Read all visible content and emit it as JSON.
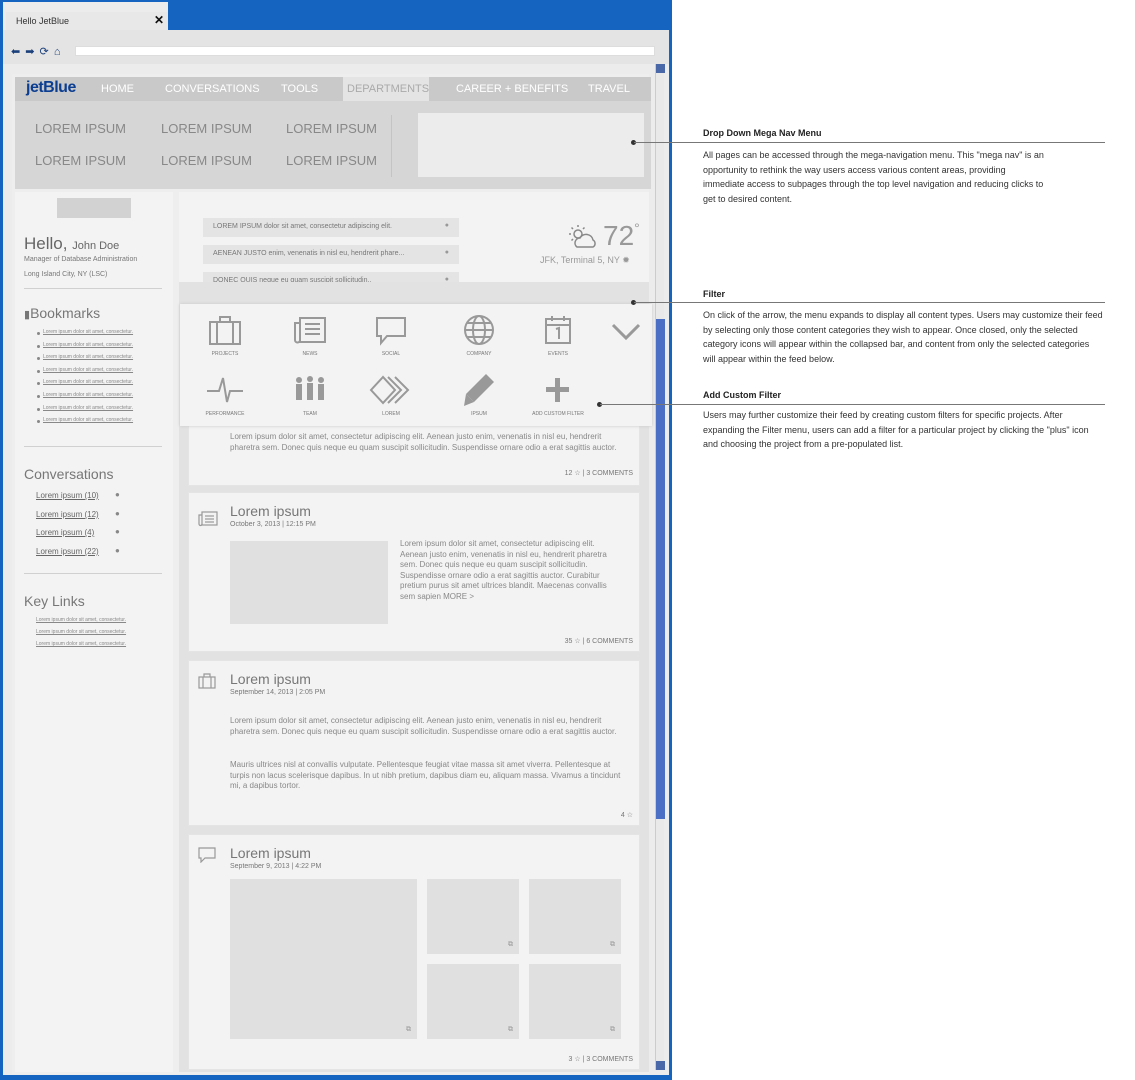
{
  "browser": {
    "tab_title": "Hello JetBlue",
    "close_glyph": "✕",
    "nav_glyphs": "⬅ ➡ ⟳ ⌂"
  },
  "header": {
    "logo": "jetBlue",
    "nav": [
      "HOME",
      "CONVERSATIONS",
      "TOOLS",
      "DEPARTMENTS",
      "CAREER + BENEFITS",
      "TRAVEL"
    ],
    "active_nav": "DEPARTMENTS"
  },
  "mega_nav": {
    "links": [
      "LOREM IPSUM",
      "LOREM IPSUM",
      "LOREM IPSUM",
      "LOREM IPSUM",
      "LOREM IPSUM",
      "LOREM IPSUM"
    ]
  },
  "sidebar": {
    "hello": "Hello,",
    "user_name": "John Doe",
    "role": "Manager of Database Administration",
    "location": "Long Island City, NY (LSC)",
    "bookmarks_title": "Bookmarks",
    "bookmarks": [
      "Lorem ipsum dolor sit amet, consectetur.",
      "Lorem ipsum dolor sit amet, consectetur.",
      "Lorem ipsum dolor sit amet, consectetur.",
      "Lorem ipsum dolor sit amet, consectetur.",
      "Lorem ipsum dolor sit amet, consectetur.",
      "Lorem ipsum dolor sit amet, consectetur.",
      "Lorem ipsum dolor sit amet, consectetur.",
      "Lorem ipsum dolor sit amet, consectetur."
    ],
    "conversations_title": "Conversations",
    "conversations": [
      "Lorem ipsum (10)",
      "Lorem ipsum (12)",
      "Lorem ipsum (4)",
      "Lorem ipsum (22)"
    ],
    "key_links_title": "Key Links",
    "key_links": [
      "Lorem ipsum dolor sit amet, consectetur.",
      "Lorem ipsum dolor sit amet, consectetur.",
      "Lorem ipsum dolor sit amet, consectetur."
    ]
  },
  "notifications": [
    "LOREM IPSUM dolor sit amet, consectetur adipiscing elit.",
    "AENEAN JUSTO enim, venenatis in nisl eu, hendrerit phare...",
    "DONEC QUIS neque eu quam suscipit sollicitudin.."
  ],
  "weather": {
    "temp": "72",
    "degree": "°",
    "location": "JFK, Terminal 5, NY"
  },
  "filters": [
    {
      "label": "PROJECTS",
      "icon": "briefcase-icon"
    },
    {
      "label": "NEWS",
      "icon": "newspaper-icon"
    },
    {
      "label": "SOCIAL",
      "icon": "speech-bubble-icon"
    },
    {
      "label": "COMPANY",
      "icon": "globe-icon"
    },
    {
      "label": "EVENTS",
      "icon": "calendar-icon"
    },
    {
      "label": "PERFORMANCE",
      "icon": "pulse-icon"
    },
    {
      "label": "TEAM",
      "icon": "team-icon"
    },
    {
      "label": "LOREM",
      "icon": "chevrons-icon"
    },
    {
      "label": "IPSUM",
      "icon": "pencil-icon"
    },
    {
      "label": "ADD CUSTOM FILTER",
      "icon": "plus-icon"
    }
  ],
  "feed": {
    "card0": {
      "text": "Lorem ipsum dolor sit amet, consectetur adipiscing elit. Aenean justo enim, venenatis in nisl eu, hendrerit pharetra sem. Donec quis neque eu quam suscipit sollicitudin. Suspendisse ornare odio a erat sagittis auctor.",
      "stats": "12 ☆ | 3 COMMENTS"
    },
    "card1": {
      "title": "Lorem ipsum",
      "date": "October 3, 2013 | 12:15 PM",
      "text": "Lorem ipsum dolor sit amet, consectetur adipiscing elit. Aenean justo enim, venenatis in nisl eu, hendrerit pharetra sem. Donec quis neque eu quam suscipit sollicitudin. Suspendisse ornare odio a erat sagittis auctor. Curabitur pretium purus sit amet ultrices blandit. Maecenas convallis sem sapien MORE >",
      "stats": "35 ☆ | 6 COMMENTS"
    },
    "card2": {
      "title": "Lorem ipsum",
      "date": "September 14, 2013 | 2:05 PM",
      "text1": "Lorem ipsum dolor sit amet, consectetur adipiscing elit. Aenean justo enim, venenatis in nisl eu, hendrerit pharetra sem. Donec quis neque eu quam suscipit sollicitudin. Suspendisse ornare odio a erat sagittis auctor.",
      "text2": "Mauris ultrices nisl at convallis vulputate. Pellentesque feugiat vitae massa sit amet viverra. Pellentesque at turpis non lacus scelerisque dapibus. In ut nibh pretium, dapibus diam eu, aliquam massa. Vivamus a tincidunt mi, a dapibus tortor.",
      "stats": "4 ☆"
    },
    "card3": {
      "title": "Lorem ipsum",
      "date": "September 9, 2013 | 4:22 PM",
      "stats": "3 ☆ | 3 COMMENTS",
      "ext_glyph": "⧉"
    }
  },
  "annotations": [
    {
      "title": "Drop Down Mega Nav Menu",
      "body": "All pages can be accessed through the mega-navigation menu. This \"mega nav\" is an opportunity to rethink the way users access various content areas, providing immediate access to subpages through the top level navigation and reducing clicks to get to desired content."
    },
    {
      "title": "Filter",
      "body": "On click of the arrow, the menu expands to display all content types. Users may customize their feed by selecting only those content categories they wish to appear. Once closed, only the selected category icons will appear within the collapsed bar, and content from only the selected categories will appear within the feed below."
    },
    {
      "title": "Add Custom Filter",
      "body": "Users may further customize their feed by creating custom filters for specific projects. After expanding the Filter menu, users can add a filter for a particular project by clicking the \"plus\" icon and choosing the project from a pre-populated list."
    }
  ],
  "colors": {
    "window_frame": "#1565c0",
    "logo": "#0b3d91",
    "nav_bar": "#c9c9c9"
  }
}
